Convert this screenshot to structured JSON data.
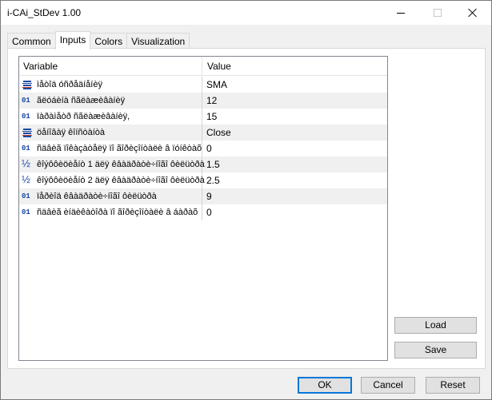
{
  "window": {
    "title": "i-CAi_StDev 1.00"
  },
  "tabs": [
    {
      "label": "Common"
    },
    {
      "label": "Inputs"
    },
    {
      "label": "Colors"
    },
    {
      "label": "Visualization"
    }
  ],
  "active_tab": "Inputs",
  "grid": {
    "col_variable": "Variable",
    "col_value": "Value",
    "rows": [
      {
        "icon": "enum-icon",
        "variable": "ìåòîä óñðåäíåíèÿ",
        "value": "SMA"
      },
      {
        "icon": "int-icon",
        "variable": "ãëóáèíà ñãëàæèâàíèÿ",
        "value": "12"
      },
      {
        "icon": "int-icon",
        "variable": "ïàðàìåòð ñãëàæèâàíèÿ,",
        "value": "15"
      },
      {
        "icon": "enum-icon",
        "variable": "öåíîâàÿ êîíñòàíòà",
        "value": "Close"
      },
      {
        "icon": "int-icon",
        "variable": "ñäâèã ïîêàçàòåëÿ ïî ãîðèçîíòàëè â ïóíêòàõ",
        "value": "0"
      },
      {
        "icon": "double-icon",
        "variable": "êîýôôèöèåíò 1 äëÿ êâàäðàòè÷íîãî ôèëüòðà",
        "value": "1.5"
      },
      {
        "icon": "double-icon",
        "variable": "êîýôôèöèåíò 2 äëÿ êâàäðàòè÷íîãî ôèëüòðà",
        "value": "2.5"
      },
      {
        "icon": "int-icon",
        "variable": "ïåðèîä êâàäðàòè÷íîãî ôèëüòðà",
        "value": "9"
      },
      {
        "icon": "int-icon",
        "variable": "ñäâèã èíäèêàòîðà ïî ãîðèçîíòàëè â áàðàõ",
        "value": "0"
      }
    ]
  },
  "side_buttons": {
    "load": "Load",
    "save": "Save"
  },
  "bottom_buttons": {
    "ok": "OK",
    "cancel": "Cancel",
    "reset": "Reset"
  },
  "icons": {
    "int_glyph": "01",
    "double_glyph": "½"
  },
  "colors": {
    "accent": "#0078d7",
    "icon_blue": "#1b4aa5"
  }
}
